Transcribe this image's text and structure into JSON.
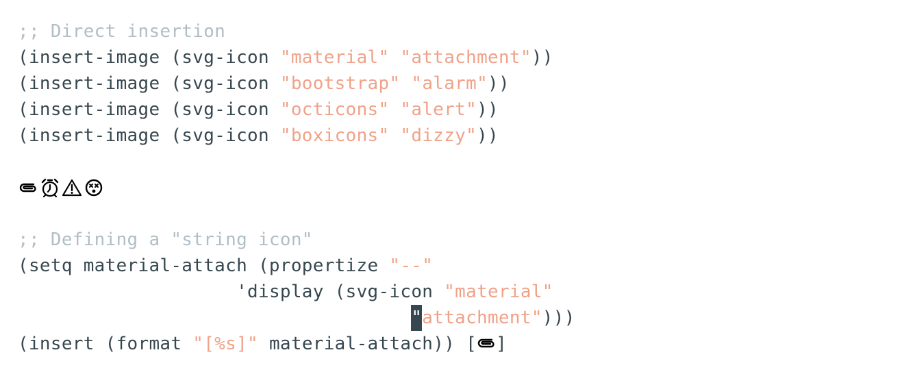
{
  "editor": {
    "comment_direct": ";; Direct insertion",
    "line1_code": "(insert-image (svg-icon ",
    "line1_str1": "\"material\"",
    "line1_str2": "\"attachment\"",
    "line1_end": "))",
    "line2_code": "(insert-image (svg-icon ",
    "line2_str1": "\"bootstrap\"",
    "line2_str2": "\"alarm\"",
    "line2_end": "))",
    "line3_code": "(insert-image (svg-icon ",
    "line3_str1": "\"octicons\"",
    "line3_str2": "\"alert\"",
    "line3_end": "))",
    "line4_code": "(insert-image (svg-icon ",
    "line4_str1": "\"boxicons\"",
    "line4_str2": "\"dizzy\"",
    "line4_end": "))",
    "rendered_icons": [
      "attachment-icon",
      "alarm-icon",
      "alert-icon",
      "dizzy-icon"
    ],
    "comment_string_icon": ";; Defining a \"string icon\"",
    "setq_code": "(setq material-attach (propertize ",
    "setq_str": "\"--\"",
    "display_code": "'display (svg-icon ",
    "display_str": "\"material\"",
    "attach_cursor_char": "\"",
    "attach_str_rest": "attachment\"",
    "attach_end": ")))",
    "insert_code1": "(insert (format ",
    "insert_str": "\"[%s]\"",
    "insert_code2": " material-attach)) ",
    "result_open": "[",
    "result_close": "]"
  },
  "colors": {
    "background": "#ffffff",
    "code": "#37474f",
    "comment": "#b0bec5",
    "string": "#f0a289",
    "cursor_bg": "#37474f"
  }
}
